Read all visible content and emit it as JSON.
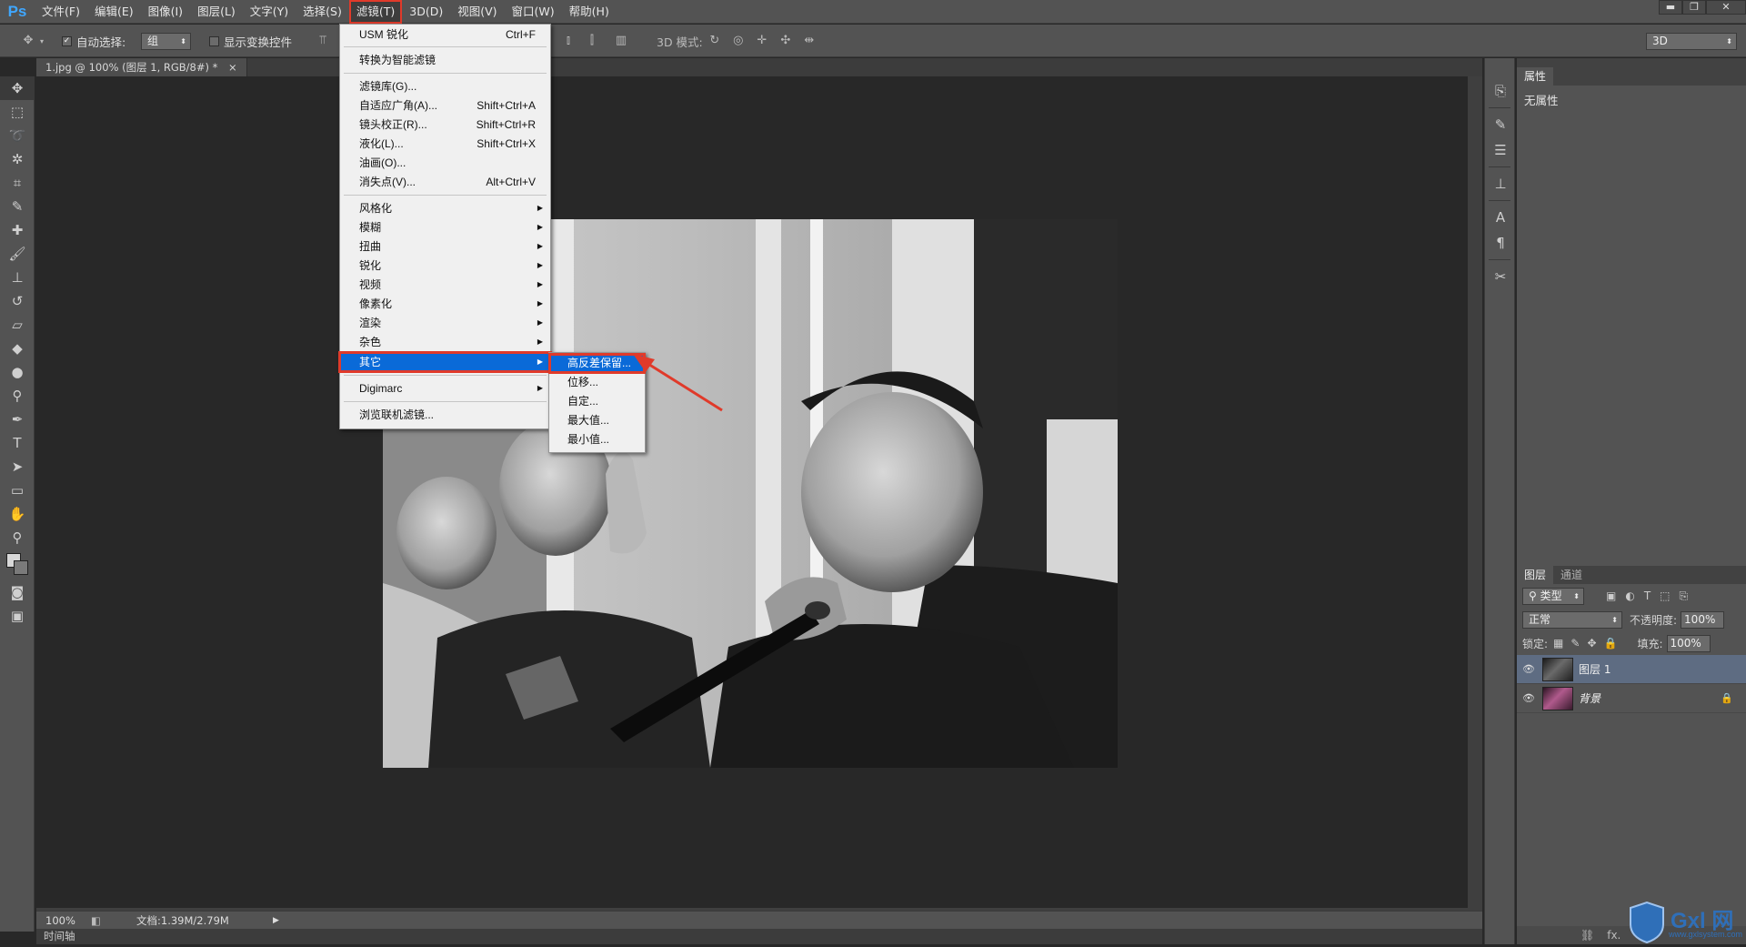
{
  "app": {
    "logo": "Ps"
  },
  "menubar": {
    "items": [
      "文件(F)",
      "编辑(E)",
      "图像(I)",
      "图层(L)",
      "文字(Y)",
      "选择(S)",
      "滤镜(T)",
      "3D(D)",
      "视图(V)",
      "窗口(W)",
      "帮助(H)"
    ],
    "active_index": 6
  },
  "window_controls": {
    "minimize": "▬",
    "restore": "❐",
    "close": "✕"
  },
  "options": {
    "auto_select_label": "自动选择:",
    "auto_select_value": "组",
    "show_transform_label": "显示变换控件",
    "mode3d_label": "3D 模式:",
    "workspace": "3D"
  },
  "document": {
    "tab_title": "1.jpg @ 100% (图层 1, RGB/8#) *",
    "tab_close": "×"
  },
  "status": {
    "zoom": "100%",
    "doc_info": "文档:1.39M/2.79M",
    "timeline": "时间轴"
  },
  "filter_menu": {
    "items": [
      {
        "label": "USM 锐化",
        "shortcut": "Ctrl+F"
      },
      {
        "label": "转换为智能滤镜",
        "shortcut": ""
      },
      {
        "label": "滤镜库(G)...",
        "shortcut": ""
      },
      {
        "label": "自适应广角(A)...",
        "shortcut": "Shift+Ctrl+A"
      },
      {
        "label": "镜头校正(R)...",
        "shortcut": "Shift+Ctrl+R"
      },
      {
        "label": "液化(L)...",
        "shortcut": "Shift+Ctrl+X"
      },
      {
        "label": "油画(O)...",
        "shortcut": ""
      },
      {
        "label": "消失点(V)...",
        "shortcut": "Alt+Ctrl+V"
      },
      {
        "label": "风格化",
        "shortcut": ""
      },
      {
        "label": "模糊",
        "shortcut": ""
      },
      {
        "label": "扭曲",
        "shortcut": ""
      },
      {
        "label": "锐化",
        "shortcut": ""
      },
      {
        "label": "视频",
        "shortcut": ""
      },
      {
        "label": "像素化",
        "shortcut": ""
      },
      {
        "label": "渲染",
        "shortcut": ""
      },
      {
        "label": "杂色",
        "shortcut": ""
      },
      {
        "label": "其它",
        "shortcut": ""
      },
      {
        "label": "Digimarc",
        "shortcut": ""
      },
      {
        "label": "浏览联机滤镜...",
        "shortcut": ""
      }
    ],
    "submenu_arrow": "▶",
    "highlighted": "其它"
  },
  "sub_menu": {
    "items": [
      "高反差保留...",
      "位移...",
      "自定...",
      "最大值...",
      "最小值..."
    ],
    "highlighted": "高反差保留..."
  },
  "properties_panel": {
    "tab": "属性",
    "body": "无属性"
  },
  "layers_panel": {
    "tabs": [
      "图层",
      "通道"
    ],
    "filter_kind": "类型",
    "blend_mode": "正常",
    "opacity_label": "不透明度:",
    "opacity_value": "100%",
    "lock_label": "锁定:",
    "fill_label": "填充:",
    "fill_value": "100%",
    "layers": [
      {
        "name": "图层 1",
        "selected": true
      },
      {
        "name": "背景",
        "locked": true
      }
    ],
    "footer_fx": "fx."
  },
  "watermark": {
    "brand": "Gxl 网",
    "url": "www.gxlsystem.com"
  },
  "colors": {
    "accent_blue": "#0a6ad8",
    "highlight_red": "#e03a2a",
    "ui_gray": "#535353",
    "canvas_bg": "#282828"
  }
}
